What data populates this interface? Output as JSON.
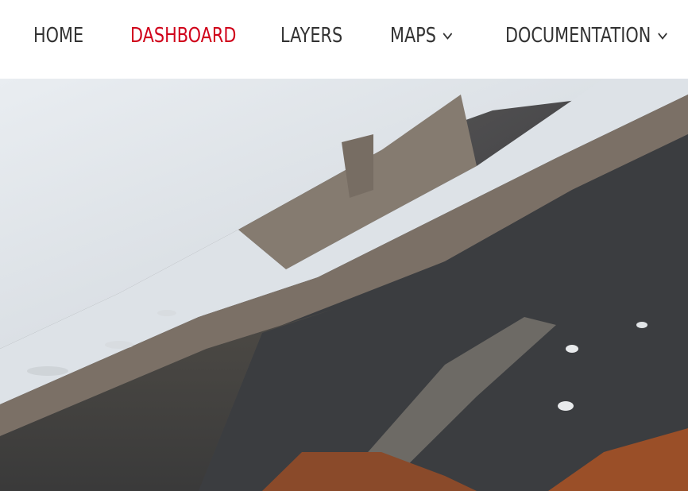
{
  "nav": {
    "items": [
      {
        "label": "HOME",
        "active": false,
        "has_dropdown": false
      },
      {
        "label": "DASHBOARD",
        "active": true,
        "has_dropdown": false
      },
      {
        "label": "LAYERS",
        "active": false,
        "has_dropdown": false
      },
      {
        "label": "MAPS",
        "active": false,
        "has_dropdown": true
      },
      {
        "label": "DOCUMENTATION",
        "active": false,
        "has_dropdown": true
      }
    ],
    "active_color": "#d0021b",
    "text_color": "#333333"
  },
  "hero": {
    "icon": "mountain-landscape-photo"
  }
}
